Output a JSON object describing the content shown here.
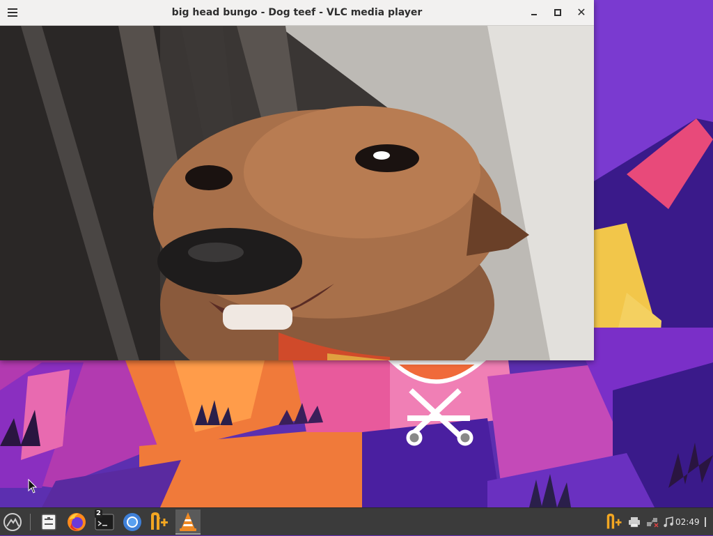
{
  "window": {
    "title": "big head bungo - Dog teef - VLC media player",
    "menu_icon": "hamburger-menu-icon",
    "minimize_icon": "minimize-icon",
    "maximize_icon": "maximize-icon",
    "close_icon": "close-icon",
    "close_glyph": "✕"
  },
  "video": {
    "content": "close-up of a brown dog in front of a metal gate"
  },
  "taskbar": {
    "launcher_icon": "start-menu-icon",
    "items": [
      {
        "name": "file-manager-icon"
      },
      {
        "name": "firefox-icon"
      },
      {
        "name": "terminal-icon",
        "badge": "2"
      },
      {
        "name": "chromium-icon"
      },
      {
        "name": "nplus-app-icon"
      },
      {
        "name": "vlc-icon",
        "active": true
      }
    ],
    "tray": [
      {
        "name": "nplus-tray-icon"
      },
      {
        "name": "printer-icon"
      },
      {
        "name": "network-disconnected-icon"
      },
      {
        "name": "music-icon"
      }
    ],
    "clock": "02:49",
    "power_icon": "power-icon"
  },
  "colors": {
    "titlebar": "#f2f1f0",
    "taskbar": "#3b3b3b",
    "wallpaper_purple": "#6a2fb8",
    "wallpaper_orange": "#f07a3a",
    "wallpaper_pink": "#e85a9c",
    "vlc_orange": "#f08a24"
  }
}
